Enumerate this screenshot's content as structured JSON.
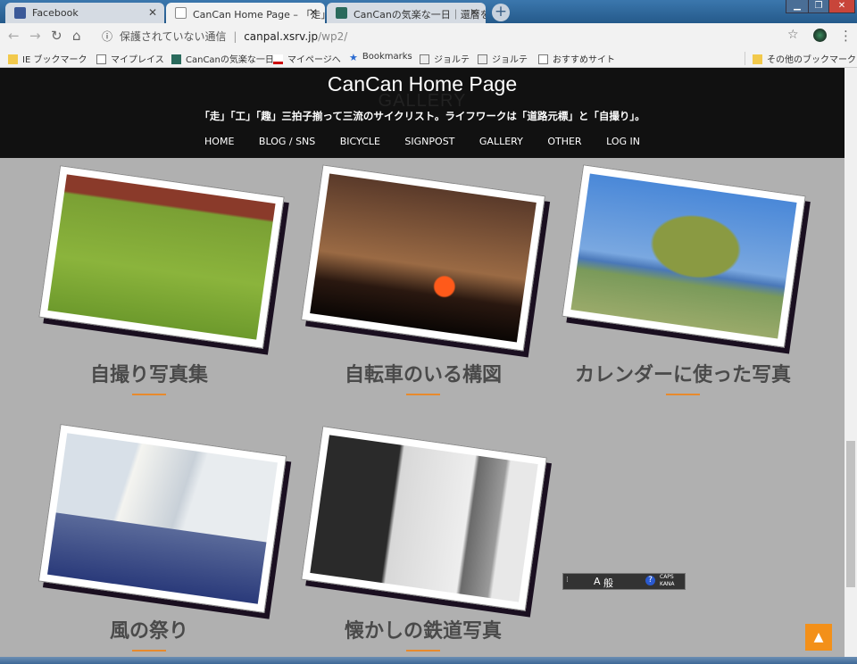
{
  "tabs": [
    {
      "title": "Facebook",
      "active": false,
      "color": "#3b5998"
    },
    {
      "title": "CanCan Home Page – 「走」",
      "active": true,
      "color": "#ffffff"
    },
    {
      "title": "CanCanの気楽な一日｜還暦を迎",
      "active": false,
      "color": "#2a6a5c"
    }
  ],
  "newtab": "+",
  "window": {
    "min": "▁",
    "max": "❐",
    "close": "✕"
  },
  "address": {
    "security": "保護されていない通信",
    "host": "canpal.xsrv.jp",
    "path": "/wp2/",
    "info_icon": "ⓘ"
  },
  "nav_icons": {
    "back": "←",
    "forward": "→",
    "reload": "↻",
    "home": "⌂",
    "star": "☆",
    "menu": "⋮"
  },
  "bookmarks": [
    {
      "label": "IE ブックマーク",
      "icon": "folder-icon"
    },
    {
      "label": "マイプレイス",
      "icon": "page-icon"
    },
    {
      "label": "CanCanの気楽な一日",
      "icon": "site-icon"
    },
    {
      "label": "マイページへ",
      "icon": "site-icon"
    },
    {
      "label": "Bookmarks",
      "icon": "star-icon"
    },
    {
      "label": "ジョルテ",
      "icon": "book-icon"
    },
    {
      "label": "ジョルテ",
      "icon": "book-icon"
    },
    {
      "label": "おすすめサイト",
      "icon": "page-icon"
    }
  ],
  "other_bookmarks": "その他のブックマーク",
  "site": {
    "title": "CanCan Home Page",
    "ghost": "GALLERY",
    "tagline": "「走」「工」「趣」三拍子揃って三流のサイクリスト。ライフワークは「道路元標」と「自撮り」。",
    "nav": [
      "HOME",
      "BLOG / SNS",
      "BICYCLE",
      "SIGNPOST",
      "GALLERY",
      "OTHER",
      "LOG IN"
    ]
  },
  "gallery": [
    {
      "title": "自撮り写真集"
    },
    {
      "title": "自転車のいる構図"
    },
    {
      "title": "カレンダーに使った写真"
    },
    {
      "title": "風の祭り"
    },
    {
      "title": "懐かしの鉄道写真"
    }
  ],
  "totop": "▲",
  "ime": {
    "a": "A",
    "b": "般",
    "caps": "CAPS",
    "kana": "KANA"
  },
  "accent": "#e88a2c"
}
